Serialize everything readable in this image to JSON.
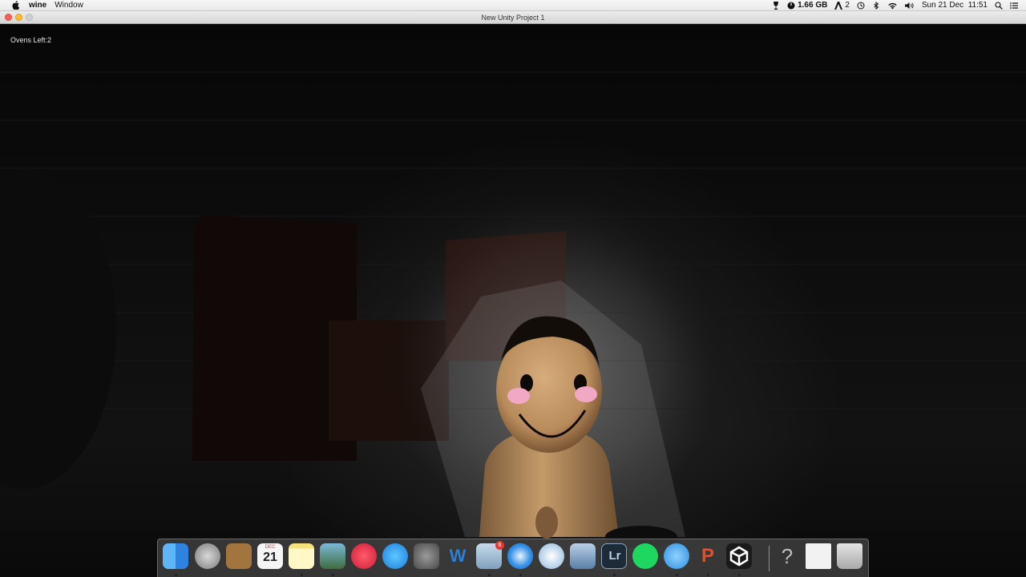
{
  "menubar": {
    "app_name": "wine",
    "menus": [
      "Window"
    ],
    "memory": "1.66 GB",
    "adobe_count": "2",
    "date_time": "Sun 21 Dec  11:51",
    "icons": [
      "apple-logo-icon",
      "wine-glass-icon",
      "memory-gauge-icon",
      "adobe-icon",
      "time-machine-icon",
      "bluetooth-icon",
      "wifi-icon",
      "volume-icon",
      "spotlight-search-icon",
      "notification-center-icon"
    ]
  },
  "window": {
    "title": "New Unity Project 1"
  },
  "game": {
    "hud_text": "Ovens Left:2"
  },
  "dock": {
    "calendar_month": "DEC",
    "calendar_day": "21",
    "photo_badge": "6",
    "help_glyph": "?",
    "lightroom_glyph": "Lr",
    "word_glyph": "W",
    "powerpoint_glyph": "P",
    "items": [
      "finder",
      "launchpad",
      "contacts",
      "calendar",
      "notes",
      "image-capture",
      "itunes",
      "app-store",
      "system-preferences",
      "word",
      "preview-photos",
      "safari",
      "weather",
      "image-viewer",
      "lightroom",
      "spotify",
      "messages",
      "powerpoint",
      "unity",
      "help",
      "document",
      "trash"
    ]
  }
}
